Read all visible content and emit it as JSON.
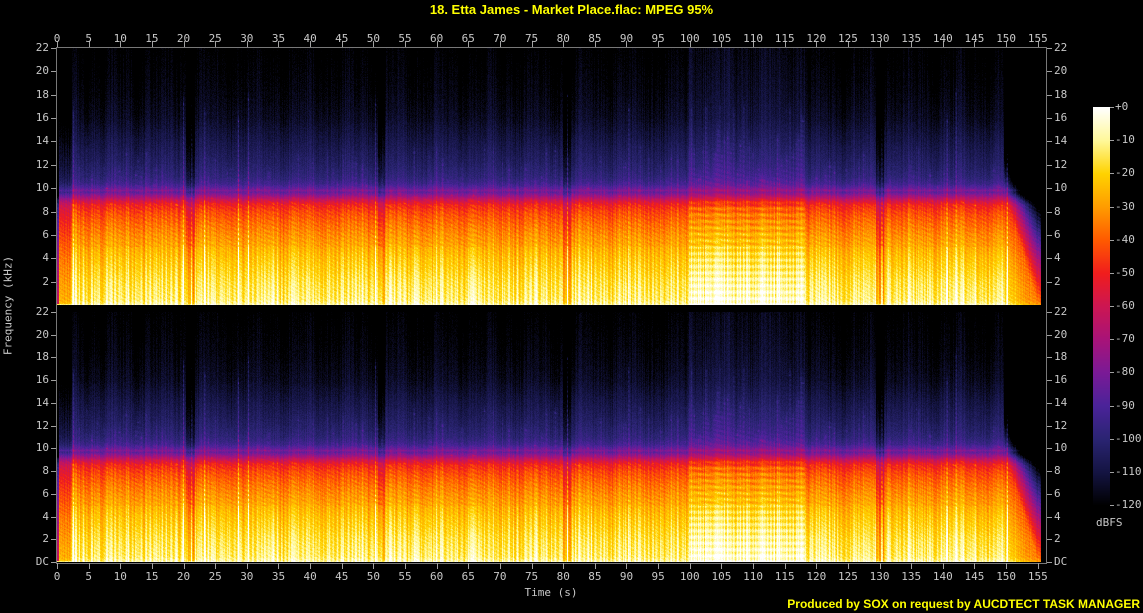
{
  "title": "18. Etta James - Market Place.flac: MPEG 95%",
  "footer": "Produced by SOX on request by AUCDTECT TASK MANAGER",
  "axes": {
    "time_label": "Time (s)",
    "freq_label": "Frequency (kHz)",
    "time_ticks": [
      0,
      5,
      10,
      15,
      20,
      25,
      30,
      35,
      40,
      45,
      50,
      55,
      60,
      65,
      70,
      75,
      80,
      85,
      90,
      95,
      100,
      105,
      110,
      115,
      120,
      125,
      130,
      135,
      140,
      145,
      150,
      155
    ],
    "freq_ticks_panel1": [
      "22",
      "20",
      "18",
      "16",
      "14",
      "12",
      "10",
      "8",
      "6",
      "4",
      "2"
    ],
    "freq_ticks_panel2": [
      "22",
      "20",
      "18",
      "16",
      "14",
      "12",
      "10",
      "8",
      "6",
      "4",
      "2",
      "DC"
    ]
  },
  "colorbar": {
    "label": "dBFS",
    "ticks": [
      "+0",
      "-10",
      "-20",
      "-30",
      "-40",
      "-50",
      "-60",
      "-70",
      "-80",
      "-90",
      "-100",
      "-110",
      "-120"
    ],
    "palette": [
      "#ffffff",
      "#fff899",
      "#ffd200",
      "#ff9c00",
      "#ff5a00",
      "#f01d1d",
      "#cc1652",
      "#a81378",
      "#7a1a96",
      "#4a2399",
      "#2a2472",
      "#141442",
      "#000000"
    ]
  },
  "colors": {
    "background": "#000000",
    "title_text": "#ffff00",
    "tick_text": "#c8c8c8",
    "axis_line": "#787878"
  },
  "chart_data": {
    "type": "heatmap",
    "subtype": "audio-spectrogram",
    "title": "18. Etta James - Market Place.flac: MPEG 95%",
    "channels": [
      "left",
      "right"
    ],
    "x": {
      "label": "Time (s)",
      "range_s": [
        0,
        156.3
      ],
      "tick_step_s": 5,
      "ticks": [
        0,
        5,
        10,
        15,
        20,
        25,
        30,
        35,
        40,
        45,
        50,
        55,
        60,
        65,
        70,
        75,
        80,
        85,
        90,
        95,
        100,
        105,
        110,
        115,
        120,
        125,
        130,
        135,
        140,
        145,
        150,
        155
      ]
    },
    "y": {
      "label": "Frequency (kHz)",
      "range_khz": [
        0,
        22
      ],
      "tick_step_khz": 2,
      "bottom_tick": "DC"
    },
    "z": {
      "label": "dBFS",
      "range_db": [
        -120,
        0
      ],
      "colorbar_ticks_db": [
        0,
        -10,
        -20,
        -30,
        -40,
        -50,
        -60,
        -70,
        -80,
        -90,
        -100,
        -110,
        -120
      ]
    },
    "legend_position": "right-colorbar",
    "grid": false,
    "content_model": {
      "spectral_profile_anchors_khz_db": [
        [
          0,
          -8
        ],
        [
          0.2,
          -13
        ],
        [
          0.5,
          -16
        ],
        [
          1,
          -17
        ],
        [
          2,
          -19
        ],
        [
          3,
          -22
        ],
        [
          4,
          -25
        ],
        [
          5,
          -29
        ],
        [
          6,
          -33
        ],
        [
          7,
          -38
        ],
        [
          8,
          -44
        ],
        [
          8.6,
          -50
        ],
        [
          9,
          -60
        ],
        [
          9.4,
          -74
        ],
        [
          9.7,
          -84
        ],
        [
          9.85,
          -78
        ],
        [
          10,
          -84
        ],
        [
          10.4,
          -92
        ],
        [
          11,
          -97
        ],
        [
          12,
          -101
        ],
        [
          13,
          -104
        ],
        [
          14,
          -107
        ],
        [
          15,
          -110
        ],
        [
          16,
          -113
        ],
        [
          18,
          -116
        ],
        [
          20,
          -118
        ],
        [
          22,
          -120
        ]
      ],
      "intro_quiet_s": [
        0,
        2.3
      ],
      "quiet_gaps_s": [
        [
          20.3,
          21.7
        ],
        [
          50.6,
          51.8
        ],
        [
          79.9,
          81.1
        ],
        [
          129.4,
          130.6
        ]
      ],
      "loud_harmonic_section_s": [
        99.8,
        118.2
      ],
      "fade_out_start_s": 149.6,
      "audio_end_s": 155.4,
      "tall_transient_times_s": [
        2.5,
        19.9,
        21.2,
        23.3,
        28.6,
        30.2,
        50.3,
        80.6,
        90.3,
        130.3,
        140.6,
        142.0,
        150.1
      ],
      "persistent_band_khz": 9.85
    }
  }
}
